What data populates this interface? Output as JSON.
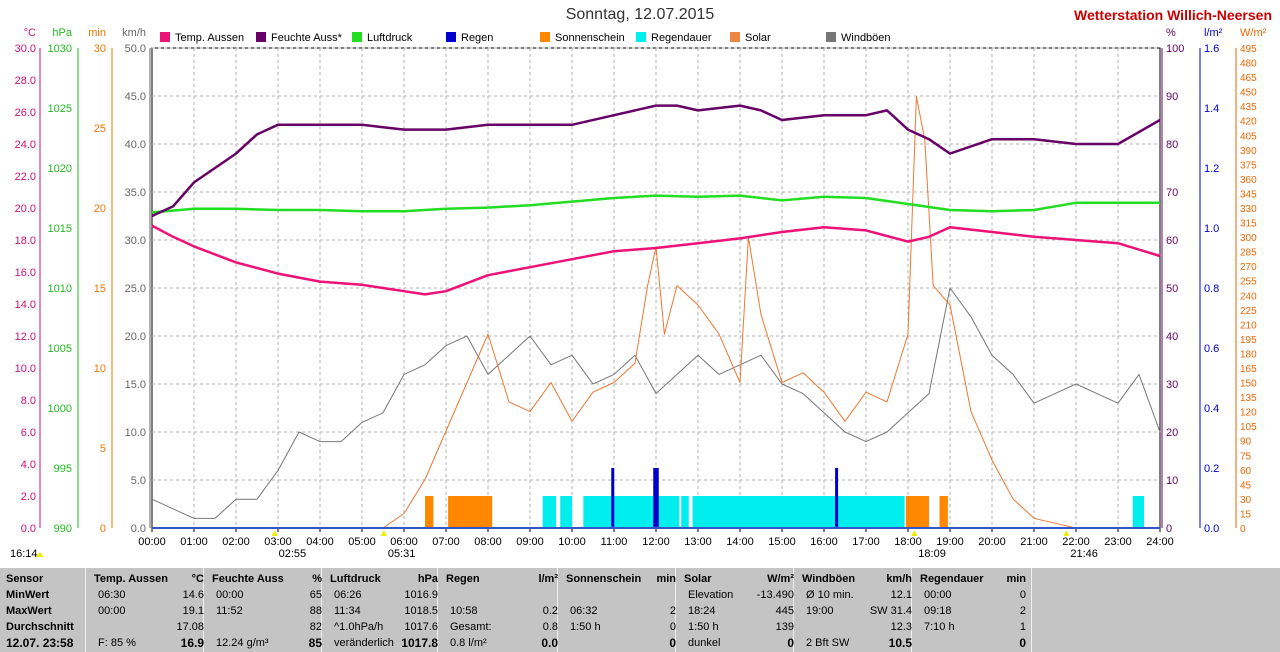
{
  "title": "Sonntag, 12.07.2015",
  "brand": "Wetterstation Willich-Neersen",
  "axes": {
    "temp": {
      "unit": "°C",
      "color": "#cc1177",
      "ticks": [
        "30.0",
        "28.0",
        "26.0",
        "24.0",
        "22.0",
        "20.0",
        "18.0",
        "16.0",
        "14.0",
        "12.0",
        "10.0",
        "8.0",
        "6.0",
        "4.0",
        "2.0",
        "0.0"
      ]
    },
    "pressure": {
      "unit": "hPa",
      "color": "#22bb22",
      "ticks": [
        "1030",
        "1025",
        "1020",
        "1015",
        "1010",
        "1005",
        "1000",
        "995",
        "990"
      ]
    },
    "minutes": {
      "unit": "min",
      "color": "#ee7700",
      "ticks": [
        "30",
        "25",
        "20",
        "15",
        "10",
        "5",
        "0"
      ]
    },
    "wind": {
      "unit": "km/h",
      "color": "#666666",
      "ticks": [
        "50.0",
        "45.0",
        "40.0",
        "35.0",
        "30.0",
        "25.0",
        "20.0",
        "15.0",
        "10.0",
        "5.0",
        "0.0"
      ]
    },
    "humidity": {
      "unit": "%",
      "color": "#660066",
      "ticks": [
        "100",
        "90",
        "80",
        "70",
        "60",
        "50",
        "40",
        "30",
        "20",
        "10",
        "0"
      ]
    },
    "rain": {
      "unit": "l/m²",
      "color": "#0000cc",
      "ticks": [
        "1.6",
        "1.4",
        "1.2",
        "1.0",
        "0.8",
        "0.6",
        "0.4",
        "0.2",
        "0.0"
      ]
    },
    "solar": {
      "unit": "W/m²",
      "color": "#ee6600",
      "ticks": [
        "495",
        "480",
        "465",
        "450",
        "435",
        "420",
        "405",
        "390",
        "375",
        "360",
        "345",
        "330",
        "315",
        "300",
        "285",
        "270",
        "255",
        "240",
        "225",
        "210",
        "195",
        "180",
        "165",
        "150",
        "135",
        "120",
        "105",
        "90",
        "75",
        "60",
        "45",
        "30",
        "15",
        "0"
      ]
    }
  },
  "legend": [
    {
      "label": "Temp. Aussen",
      "color": "#ee1177"
    },
    {
      "label": "Feuchte Auss*",
      "color": "#660066"
    },
    {
      "label": "Luftdruck",
      "color": "#22dd22"
    },
    {
      "label": "Regen",
      "color": "#0000cc"
    },
    {
      "label": "Sonnenschein",
      "color": "#ff8800"
    },
    {
      "label": "Regendauer",
      "color": "#00eeee"
    },
    {
      "label": "Solar",
      "color": "#ee8844"
    },
    {
      "label": "Windböen",
      "color": "#777777"
    }
  ],
  "x_ticks": [
    "00:00",
    "01:00",
    "02:00",
    "03:00",
    "04:00",
    "05:00",
    "06:00",
    "07:00",
    "08:00",
    "09:00",
    "10:00",
    "11:00",
    "12:00",
    "13:00",
    "14:00",
    "15:00",
    "16:00",
    "17:00",
    "18:00",
    "19:00",
    "20:00",
    "21:00",
    "22:00",
    "23:00",
    "24:00"
  ],
  "markers": [
    {
      "label": "16:14",
      "hour": -1.8,
      "row": 2,
      "color": "#eeee00"
    },
    {
      "label": "02:55",
      "hour": 2.92,
      "row": 1,
      "color": "#eeee00"
    },
    {
      "label": "05:31",
      "hour": 5.52,
      "row": 2,
      "color": "#eeee00"
    },
    {
      "label": "18:09",
      "hour": 18.15,
      "row": 1,
      "color": "#eeee00"
    },
    {
      "label": "21:46",
      "hour": 21.77,
      "row": 2,
      "color": "#eeee00"
    }
  ],
  "chart_data": {
    "type": "line",
    "x_unit": "hour of day",
    "xlim": [
      0,
      24
    ],
    "series": [
      {
        "name": "Temp. Aussen",
        "unit": "°C",
        "axis": "temp",
        "ylim": [
          0,
          30
        ],
        "x": [
          0,
          0.5,
          1,
          2,
          3,
          4,
          5,
          6,
          6.5,
          7,
          8,
          9,
          10,
          11,
          12,
          13,
          14,
          15,
          16,
          17,
          18,
          18.5,
          19,
          20,
          21,
          22,
          23,
          24
        ],
        "y": [
          18.9,
          18.2,
          17.6,
          16.6,
          15.9,
          15.4,
          15.2,
          14.8,
          14.6,
          14.8,
          15.8,
          16.3,
          16.8,
          17.3,
          17.5,
          17.8,
          18.1,
          18.5,
          18.8,
          18.6,
          17.9,
          18.2,
          18.8,
          18.5,
          18.2,
          18.0,
          17.8,
          17.0
        ]
      },
      {
        "name": "Feuchte Auss*",
        "unit": "%",
        "axis": "humidity",
        "ylim": [
          0,
          100
        ],
        "x": [
          0,
          0.5,
          1,
          2,
          2.5,
          3,
          4,
          5,
          6,
          7,
          8,
          9,
          10,
          11,
          12,
          12.5,
          13,
          14,
          14.5,
          15,
          16,
          17,
          17.5,
          18,
          18.5,
          19,
          20,
          21,
          22,
          23,
          24
        ],
        "y": [
          65,
          67,
          72,
          78,
          82,
          84,
          84,
          84,
          83,
          83,
          84,
          84,
          84,
          86,
          88,
          88,
          87,
          88,
          87,
          85,
          86,
          86,
          87,
          83,
          81,
          78,
          81,
          81,
          80,
          80,
          85
        ]
      },
      {
        "name": "Luftdruck",
        "unit": "hPa",
        "axis": "pressure",
        "ylim": [
          990,
          1030
        ],
        "x": [
          0,
          1,
          2,
          3,
          4,
          5,
          6,
          7,
          8,
          9,
          10,
          11,
          12,
          13,
          14,
          15,
          16,
          17,
          18,
          19,
          20,
          21,
          22,
          23,
          24
        ],
        "y": [
          1016.3,
          1016.6,
          1016.6,
          1016.5,
          1016.5,
          1016.4,
          1016.4,
          1016.6,
          1016.7,
          1016.9,
          1017.2,
          1017.5,
          1017.7,
          1017.6,
          1017.7,
          1017.3,
          1017.6,
          1017.5,
          1017.0,
          1016.5,
          1016.4,
          1016.5,
          1017.1,
          1017.1,
          1017.1
        ]
      },
      {
        "name": "Windböen",
        "unit": "km/h",
        "axis": "wind",
        "ylim": [
          0,
          50
        ],
        "x": [
          0,
          0.5,
          1,
          1.5,
          2,
          2.5,
          3,
          3.5,
          4,
          4.5,
          5,
          5.5,
          6,
          6.5,
          7,
          7.5,
          8,
          8.5,
          9,
          9.5,
          10,
          10.5,
          11,
          11.5,
          12,
          12.5,
          13,
          13.5,
          14,
          14.5,
          15,
          15.5,
          16,
          16.5,
          17,
          17.5,
          18,
          18.5,
          19,
          19.5,
          20,
          20.5,
          21,
          21.5,
          22,
          22.5,
          23,
          23.5,
          24
        ],
        "y": [
          3,
          2,
          1,
          1,
          3,
          3,
          6,
          10,
          9,
          9,
          11,
          12,
          16,
          17,
          19,
          20,
          16,
          18,
          20,
          17,
          18,
          15,
          16,
          18,
          14,
          16,
          18,
          16,
          17,
          18,
          15,
          14,
          12,
          10,
          9,
          10,
          12,
          14,
          25,
          22,
          18,
          16,
          13,
          14,
          15,
          14,
          13,
          16,
          10
        ]
      },
      {
        "name": "Solar",
        "unit": "W/m²",
        "axis": "solar",
        "ylim": [
          0,
          495
        ],
        "x": [
          0,
          5.5,
          6,
          6.5,
          7,
          7.5,
          7.8,
          8,
          8.5,
          9,
          9.5,
          10,
          10.5,
          11,
          11.5,
          11.8,
          12,
          12.2,
          12.5,
          13,
          13.5,
          14,
          14.2,
          14.5,
          15,
          15.5,
          16,
          16.5,
          17,
          17.5,
          18,
          18.2,
          18.4,
          18.6,
          19,
          19.5,
          20,
          20.5,
          21,
          21.5,
          22,
          24
        ],
        "y": [
          0,
          0,
          15,
          50,
          100,
          150,
          180,
          200,
          130,
          120,
          150,
          110,
          140,
          150,
          170,
          250,
          290,
          200,
          250,
          230,
          200,
          150,
          300,
          220,
          150,
          160,
          140,
          110,
          140,
          130,
          200,
          445,
          400,
          250,
          230,
          120,
          70,
          30,
          10,
          5,
          0,
          0
        ]
      },
      {
        "name": "Regen",
        "unit": "l/m²",
        "axis": "rain",
        "ylim": [
          0,
          1.6
        ],
        "x": [
          10.97,
          11.97,
          12.0,
          12.03,
          16.3
        ],
        "y": [
          0.2,
          0.2,
          0.2,
          0.2,
          0.2
        ]
      }
    ],
    "bars": [
      {
        "name": "Sonnenschein",
        "unit": "min",
        "axis": "minutes",
        "ylim": [
          0,
          30
        ],
        "ranges": [
          [
            6.5,
            6.7,
            2
          ],
          [
            7.05,
            8.1,
            2
          ],
          [
            17.95,
            18.5,
            2
          ],
          [
            18.75,
            18.95,
            2
          ]
        ]
      },
      {
        "name": "Regendauer",
        "unit": "min",
        "axis": "minutes",
        "ylim": [
          0,
          30
        ],
        "ranges": [
          [
            9.3,
            9.62,
            2
          ],
          [
            9.72,
            10.0,
            2
          ],
          [
            10.27,
            12.55,
            2
          ],
          [
            12.6,
            12.78,
            2
          ],
          [
            12.87,
            17.92,
            2
          ],
          [
            23.35,
            23.62,
            2
          ]
        ]
      }
    ]
  },
  "table": {
    "date": "12.07. 23:58",
    "columns": [
      {
        "key": "sensor",
        "header": "Sensor",
        "unit": "",
        "rows": [
          "MinWert",
          "MaxWert",
          "Durchschnitt"
        ]
      },
      {
        "key": "temp",
        "header": "Temp. Aussen",
        "unit": "°C",
        "rows": [
          [
            "06:30",
            "14.6"
          ],
          [
            "00:00",
            "19.1"
          ],
          [
            "",
            "17.08"
          ]
        ],
        "last": [
          "F: 85 %",
          "16.9"
        ]
      },
      {
        "key": "hum",
        "header": "Feuchte Auss",
        "unit": "%",
        "rows": [
          [
            "00:00",
            "65"
          ],
          [
            "11:52",
            "88"
          ],
          [
            "",
            "82"
          ]
        ],
        "last": [
          "12.24 g/m³",
          "85"
        ]
      },
      {
        "key": "press",
        "header": "Luftdruck",
        "unit": "hPa",
        "rows": [
          [
            "06:26",
            "1016.9"
          ],
          [
            "11:34",
            "1018.5"
          ],
          [
            "^1.0hPa/h",
            "1017.6"
          ]
        ],
        "last": [
          "veränderlich",
          "1017.8"
        ]
      },
      {
        "key": "rain",
        "header": "Regen",
        "unit": "l/m²",
        "rows": [
          [
            "",
            ""
          ],
          [
            "10:58",
            "0.2"
          ],
          [
            "Gesamt:",
            "0.8"
          ]
        ],
        "last": [
          "0.8 l/m²",
          "0.0"
        ]
      },
      {
        "key": "sun",
        "header": "Sonnenschein",
        "unit": "min",
        "rows": [
          [
            "",
            ""
          ],
          [
            "06:32",
            "2"
          ],
          [
            "1:50 h",
            "0"
          ]
        ],
        "last": [
          "",
          "0"
        ]
      },
      {
        "key": "solar",
        "header": "Solar",
        "unit": "W/m²",
        "rows": [
          [
            "Elevation",
            "-13.490"
          ],
          [
            "18:24",
            "445"
          ],
          [
            "1:50 h",
            "139"
          ]
        ],
        "last": [
          "dunkel",
          "0"
        ]
      },
      {
        "key": "wind",
        "header": "Windböen",
        "unit": "km/h",
        "rows": [
          [
            "Ø 10 min.",
            "12.1"
          ],
          [
            "19:00",
            "SW 31.4"
          ],
          [
            "",
            "12.3"
          ]
        ],
        "last": [
          "2 Bft SW",
          "10.5"
        ]
      },
      {
        "key": "raindur",
        "header": "Regendauer",
        "unit": "min",
        "rows": [
          [
            "00:00",
            "0"
          ],
          [
            "09:18",
            "2"
          ],
          [
            "7:10 h",
            "1"
          ]
        ],
        "last": [
          "",
          "0"
        ]
      }
    ]
  }
}
